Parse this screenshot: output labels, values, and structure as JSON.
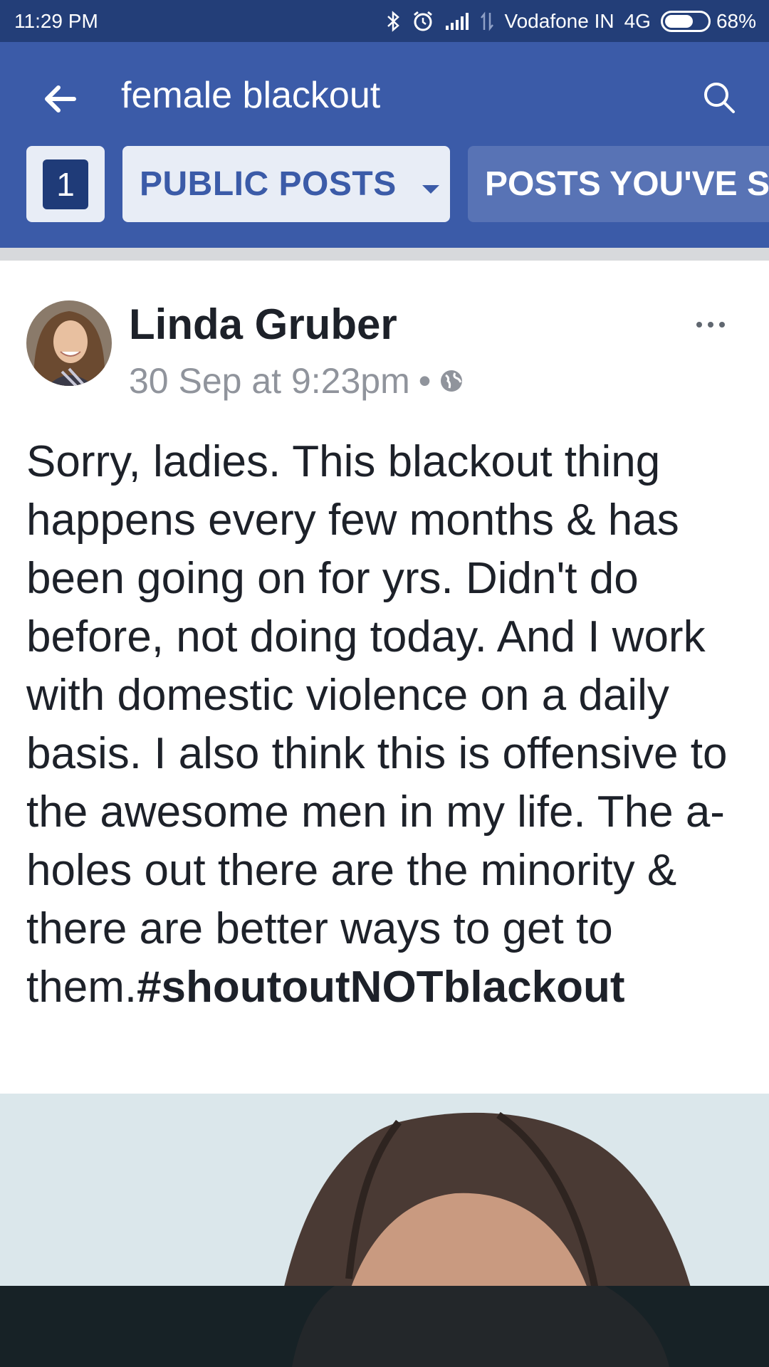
{
  "status_bar": {
    "time": "11:29 PM",
    "carrier": "Vodafone IN",
    "network": "4G",
    "battery_percent": "68%",
    "battery_level": 0.68
  },
  "app_bar": {
    "search_query": "female blackout",
    "filter_count": "1",
    "public_posts_label": "PUBLIC POSTS",
    "posts_seen_label": "POSTS YOU'VE SE"
  },
  "post": {
    "author": "Linda Gruber",
    "timestamp": "30 Sep at 9:23pm",
    "separator": "•",
    "body": "Sorry, ladies. This blackout thing happens every few months & has been going on for yrs. Didn't do before, not doing today. And I work with domestic violence on a daily basis. I also think this is offensive to the awesome men in my life. The a-holes out there are the minority & there are better ways to get to them.",
    "hashtag": "#shoutoutNOTblackout"
  },
  "icons": {
    "back": "back-arrow-icon",
    "search": "search-icon",
    "dropdown": "caret-down-icon",
    "privacy": "globe-icon",
    "more": "more-horizontal-icon"
  },
  "colors": {
    "status_bar": "#233e78",
    "app_bar": "#3b5ba8",
    "chip_bg": "#e8edf6",
    "chip_text": "#3b5ba8",
    "meta_text": "#90949c"
  }
}
